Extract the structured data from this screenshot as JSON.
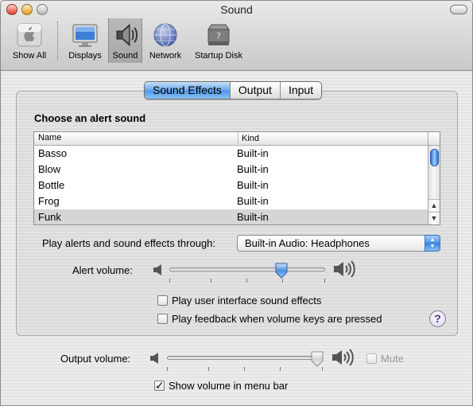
{
  "window": {
    "title": "Sound"
  },
  "toolbar": {
    "items": [
      {
        "label": "Show All",
        "icon": "apple-show-all-icon"
      },
      {
        "label": "Displays",
        "icon": "display-monitor-icon"
      },
      {
        "label": "Sound",
        "icon": "speaker-icon",
        "selected": true
      },
      {
        "label": "Network",
        "icon": "network-globe-icon"
      },
      {
        "label": "Startup Disk",
        "icon": "hard-disk-icon"
      }
    ]
  },
  "tabs": [
    {
      "label": "Sound Effects",
      "active": true
    },
    {
      "label": "Output",
      "active": false
    },
    {
      "label": "Input",
      "active": false
    }
  ],
  "alert": {
    "title": "Choose an alert sound",
    "columns": [
      "Name",
      "Kind"
    ],
    "rows": [
      {
        "name": "Basso",
        "kind": "Built-in"
      },
      {
        "name": "Blow",
        "kind": "Built-in"
      },
      {
        "name": "Bottle",
        "kind": "Built-in"
      },
      {
        "name": "Frog",
        "kind": "Built-in"
      },
      {
        "name": "Funk",
        "kind": "Built-in",
        "selected": true
      }
    ]
  },
  "play_through": {
    "label": "Play alerts and sound effects through:",
    "value": "Built-in Audio: Headphones"
  },
  "alert_volume": {
    "label": "Alert volume:",
    "level": 0.7
  },
  "options": {
    "ui_sounds": {
      "label": "Play user interface sound effects",
      "checked": false
    },
    "feedback": {
      "label": "Play feedback when volume keys are pressed",
      "checked": false
    }
  },
  "help": {
    "label": "?"
  },
  "output_volume": {
    "label": "Output volume:",
    "level": 1.0
  },
  "mute": {
    "label": "Mute",
    "checked": false,
    "disabled": true
  },
  "menu_bar": {
    "label": "Show volume in menu bar",
    "checked": true
  },
  "colors": {
    "accent": "#4d93e3",
    "selection": "#d6d6d6"
  }
}
